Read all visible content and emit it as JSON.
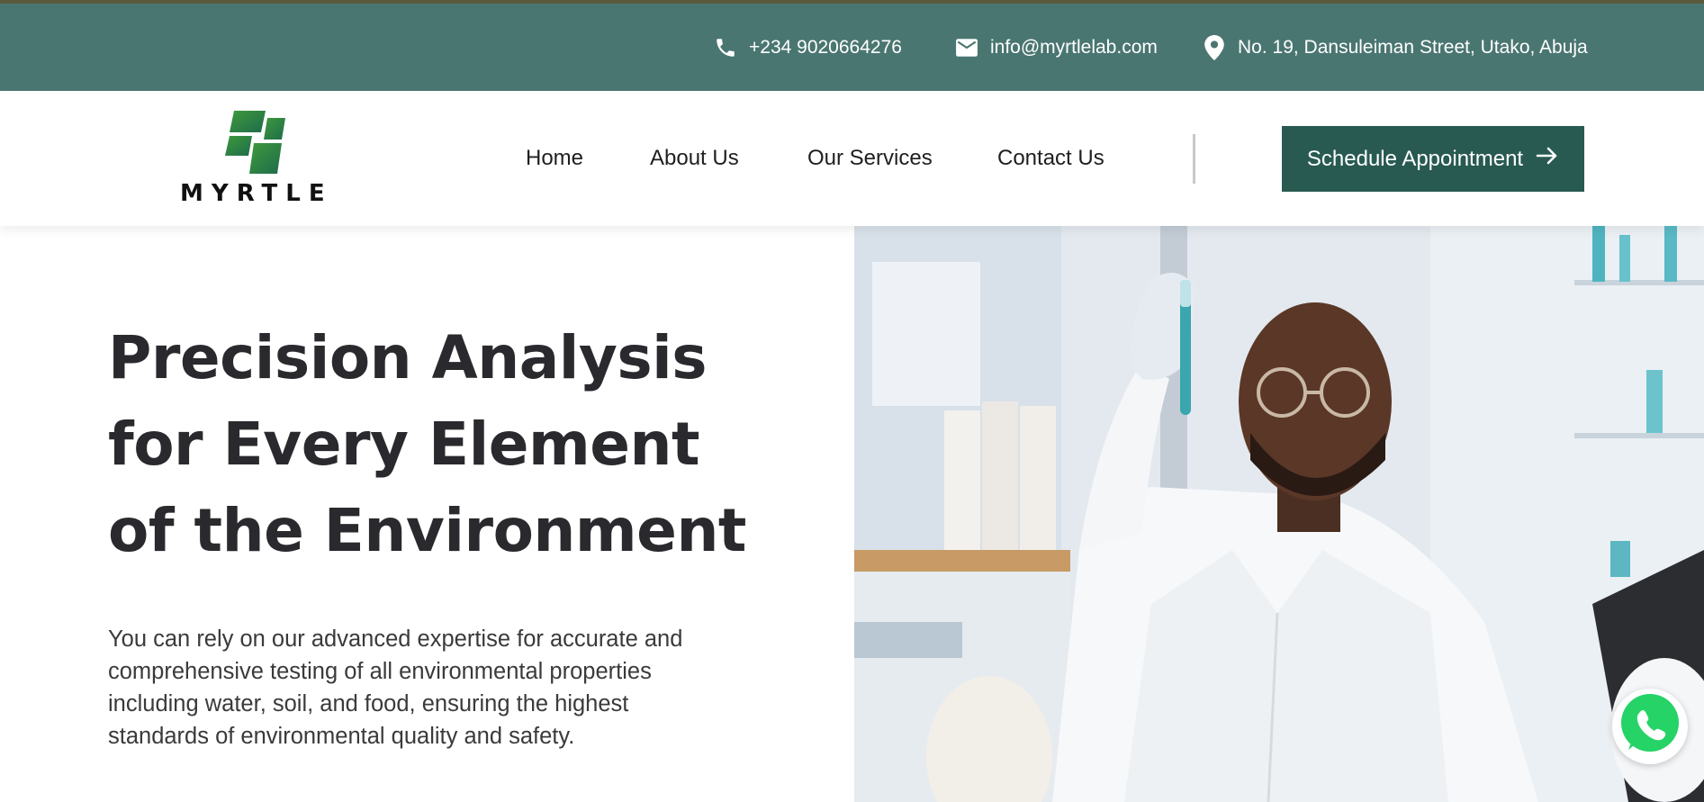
{
  "topbar": {
    "phone": "+234 9020664276",
    "email": "info@myrtlelab.com",
    "address": "No. 19, Dansuleiman Street, Utako, Abuja",
    "icons": [
      "phone-icon",
      "mail-icon",
      "location-pin-icon"
    ]
  },
  "brand": {
    "name": "MYRTLE",
    "colors": {
      "topbar_bg": "#4a7671",
      "button_bg": "#285a52",
      "logo_green_light": "#3f9a3a",
      "logo_green_dark": "#1d6b4c"
    }
  },
  "nav": {
    "items": [
      {
        "label": "Home"
      },
      {
        "label": "About Us"
      },
      {
        "label": "Our Services"
      },
      {
        "label": "Contact Us"
      }
    ],
    "cta_label": "Schedule Appointment",
    "cta_icon": "arrow-right-icon"
  },
  "hero": {
    "title_lines": [
      "Precision Analysis",
      "for Every Element",
      "of the Environment"
    ],
    "description": "You can rely on our advanced expertise for accurate and comprehensive testing of all environmental properties including water, soil, and food, ensuring the highest standards of environmental quality and safety."
  },
  "floating": {
    "whatsapp_icon": "whatsapp-icon"
  }
}
